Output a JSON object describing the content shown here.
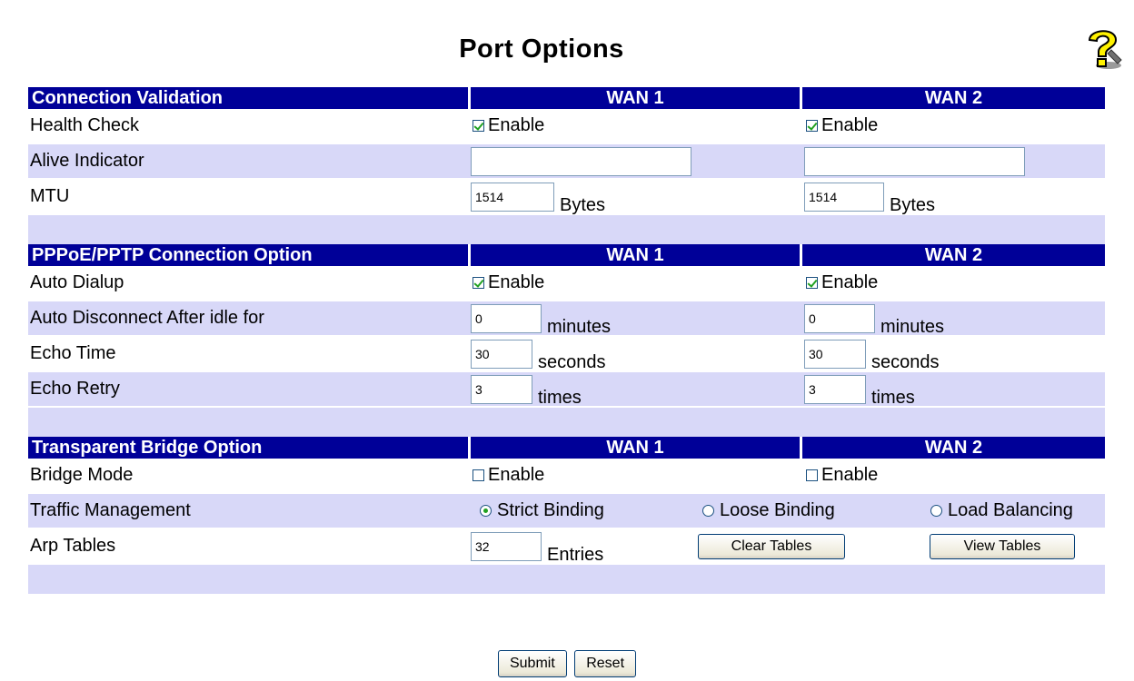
{
  "page": {
    "title": "Port Options"
  },
  "sections": {
    "connection": {
      "header": "Connection Validation",
      "wan1": "WAN 1",
      "wan2": "WAN 2",
      "health_check": {
        "label": "Health Check",
        "wan1_enable": "Enable",
        "wan2_enable": "Enable",
        "wan1_checked": true,
        "wan2_checked": true
      },
      "alive_indicator": {
        "label": "Alive Indicator",
        "wan1_value": "",
        "wan2_value": ""
      },
      "mtu": {
        "label": "MTU",
        "wan1_value": "1514",
        "wan2_value": "1514",
        "unit": "Bytes"
      }
    },
    "pppoe": {
      "header": "PPPoE/PPTP Connection Option",
      "wan1": "WAN 1",
      "wan2": "WAN 2",
      "auto_dialup": {
        "label": "Auto Dialup",
        "wan1_enable": "Enable",
        "wan2_enable": "Enable",
        "wan1_checked": true,
        "wan2_checked": true
      },
      "auto_disconnect": {
        "label": "Auto Disconnect After idle for",
        "wan1_value": "0",
        "wan2_value": "0",
        "unit": "minutes"
      },
      "echo_time": {
        "label": "Echo Time",
        "wan1_value": "30",
        "wan2_value": "30",
        "unit": "seconds"
      },
      "echo_retry": {
        "label": "Echo Retry",
        "wan1_value": "3",
        "wan2_value": "3",
        "unit": "times"
      }
    },
    "bridge": {
      "header": "Transparent Bridge Option",
      "wan1": "WAN 1",
      "wan2": "WAN 2",
      "bridge_mode": {
        "label": "Bridge Mode",
        "wan1_enable": "Enable",
        "wan2_enable": "Enable",
        "wan1_checked": false,
        "wan2_checked": false
      },
      "traffic": {
        "label": "Traffic Management",
        "strict": "Strict Binding",
        "loose": "Loose Binding",
        "balance": "Load Balancing",
        "selected": "strict"
      },
      "arp": {
        "label": "Arp Tables",
        "value": "32",
        "unit": "Entries",
        "clear_label": "Clear Tables",
        "view_label": "View Tables"
      }
    }
  },
  "actions": {
    "submit_label": "Submit",
    "reset_label": "Reset"
  },
  "colors": {
    "header_bg": "#000098",
    "row_light": "#d8d8f8"
  },
  "icons": {
    "help": "help-question-icon"
  }
}
